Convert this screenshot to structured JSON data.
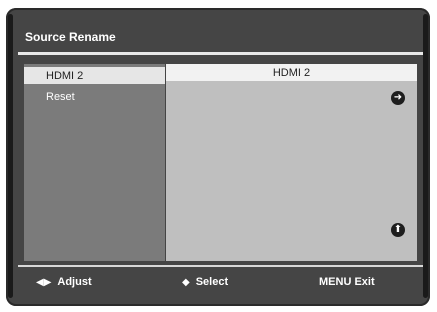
{
  "screen": {
    "title": "Source Rename"
  },
  "menu": {
    "items": [
      {
        "label": "HDMI 2",
        "selected": true
      },
      {
        "label": "Reset",
        "selected": false
      }
    ]
  },
  "value_panel": {
    "current_value": "HDMI 2",
    "right_icon": "right-arrow-circle-icon",
    "bottom_icon": "up-arrow-circle-icon"
  },
  "footer": {
    "adjust_glyph": "◀▶",
    "adjust_label": "Adjust",
    "select_glyph": "◆",
    "select_label": "Select",
    "exit_label": "MENU Exit"
  },
  "colors": {
    "frame": "#454545",
    "left_panel": "#7b7b7b",
    "right_panel": "#bfbfbf",
    "highlight": "#e6e6e6"
  }
}
